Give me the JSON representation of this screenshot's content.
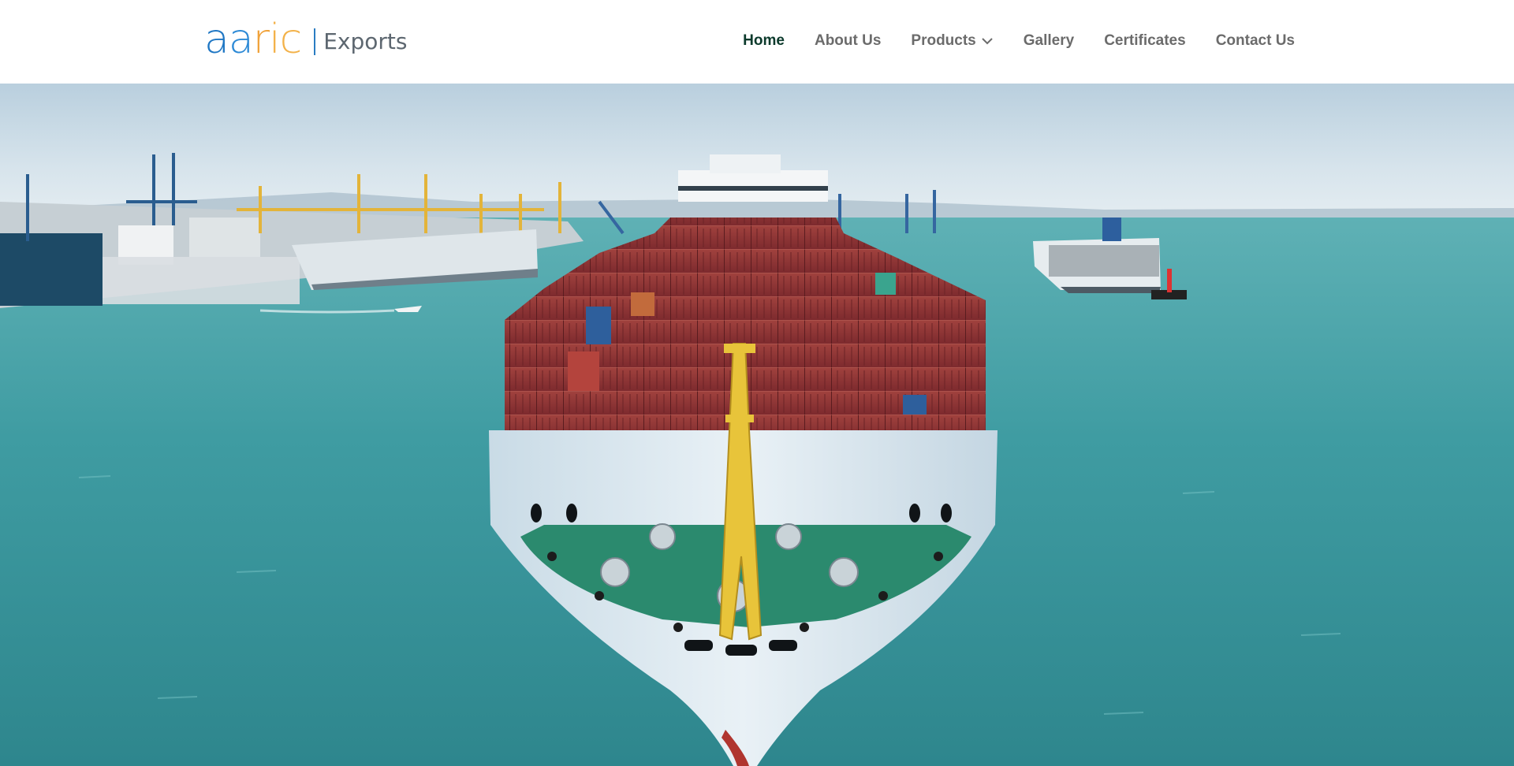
{
  "brand": {
    "logo_letters": [
      "a",
      "a",
      "r",
      "i",
      "c"
    ],
    "logo_colors": [
      "#1f77c4",
      "#2d8ad6",
      "#f0a23a",
      "#f3b24a",
      "#f3b24a"
    ],
    "tagline": "Exports",
    "separator_color": "#2a7cc2"
  },
  "nav": {
    "items": [
      {
        "label": "Home",
        "active": true
      },
      {
        "label": "About Us"
      },
      {
        "label": "Products",
        "has_dropdown": true,
        "icon": "chevron-down-icon"
      },
      {
        "label": "Gallery"
      },
      {
        "label": "Certificates"
      },
      {
        "label": "Contact Us"
      }
    ],
    "active_color": "#0c3a2c",
    "text_color": "#6b6b6b"
  },
  "hero": {
    "image": "container-ship-at-sea-photo",
    "colors": {
      "sky": "#cfdfe9",
      "sea": "#3f9aa0",
      "hull": "#dbe7ef",
      "container_red": "#8c2f32",
      "mast": "#e8c43a",
      "deck": "#2b8a6e"
    }
  }
}
